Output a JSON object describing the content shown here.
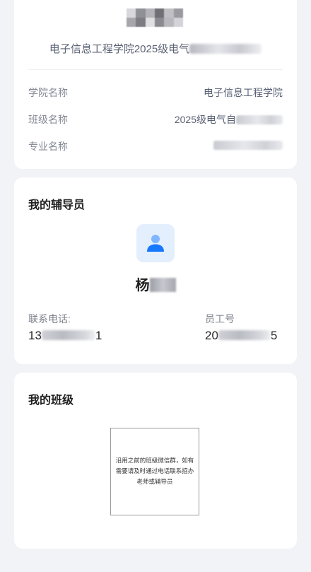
{
  "student": {
    "name": "",
    "subtitle": "电子信息工程学院2025级电气",
    "info": [
      {
        "label": "学院名称",
        "value": "电子信息工程学院"
      },
      {
        "label": "班级名称",
        "value": "2025级电气自"
      },
      {
        "label": "专业名称",
        "value": ""
      }
    ]
  },
  "counselor": {
    "title": "我的辅导员",
    "avatar_icon": "user-icon",
    "accent": "#1677ff",
    "name_visible": "杨",
    "phone_label": "联系电话:",
    "phone_prefix": "13",
    "phone_suffix": "1",
    "employee_label": "员工号",
    "employee_prefix": "20",
    "employee_suffix": "5"
  },
  "my_class": {
    "title": "我的班级",
    "notice": "沿用之前的班级微信群，如有需要请及时通过电话联系招办老师或辅导员"
  }
}
